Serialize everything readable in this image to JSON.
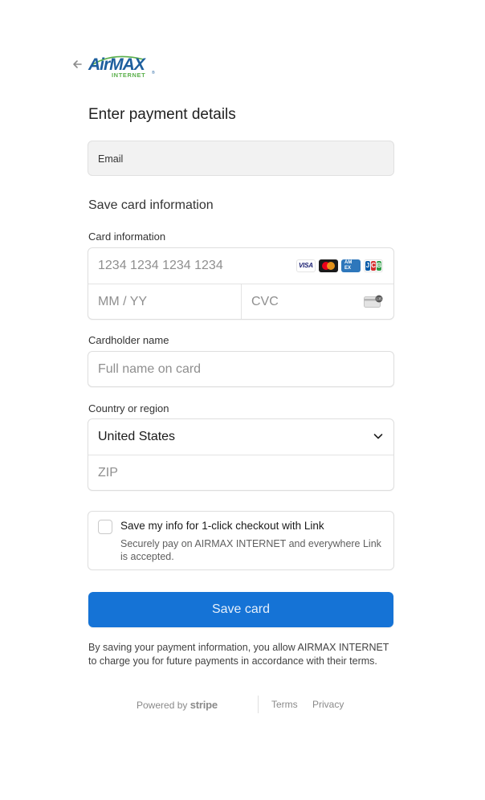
{
  "header": {
    "back_icon": "arrow-left-icon",
    "logo_text": "AirMAX INTERNET"
  },
  "title": "Enter payment details",
  "email": {
    "label": "Email"
  },
  "section_title": "Save card information",
  "card": {
    "label": "Card information",
    "number_placeholder": "1234 1234 1234 1234",
    "expiry_placeholder": "MM / YY",
    "cvc_placeholder": "CVC",
    "brands": [
      "VISA",
      "Mastercard",
      "AMEX",
      "JCB"
    ],
    "cvc_icon": "card-cvc-icon"
  },
  "cardholder": {
    "label": "Cardholder name",
    "placeholder": "Full name on card"
  },
  "country": {
    "label": "Country or region",
    "selected": "United States",
    "zip_placeholder": "ZIP"
  },
  "link_option": {
    "title": "Save my info for 1-click checkout with Link",
    "description": "Securely pay on AIRMAX INTERNET and everywhere Link is accepted."
  },
  "submit": {
    "label": "Save card"
  },
  "legal": "By saving your payment information, you allow AIRMAX INTERNET to charge you for future payments in accordance with their terms.",
  "footer": {
    "powered_by": "Powered by",
    "powered_brand": "stripe",
    "terms": "Terms",
    "privacy": "Privacy"
  },
  "colors": {
    "accent": "#1573d6",
    "logo_blue": "#1e5f9e",
    "logo_green": "#5bb04b"
  }
}
